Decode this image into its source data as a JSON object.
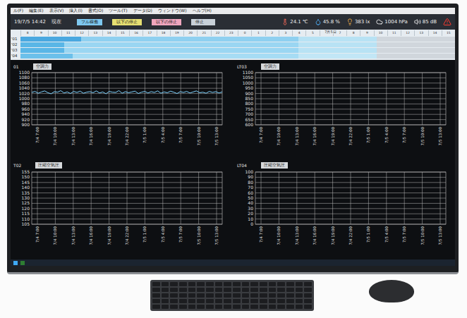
{
  "menu_bar": {
    "items": [
      "ル(F)",
      "編集(E)",
      "表示(V)",
      "挿入(I)",
      "書式(O)",
      "ツール(T)",
      "データ(D)",
      "ウィンドウ(W)",
      "ヘルプ(H)"
    ]
  },
  "toolbar": {
    "datetime": "19/7/5 14:42",
    "now_label": "現在",
    "legend": [
      {
        "label": "フル稼働",
        "color": "#7ec8f0"
      },
      {
        "label": "以下の停止",
        "color": "#e6df72"
      },
      {
        "label": "以下の停止",
        "color": "#f0a6be"
      },
      {
        "label": "停止",
        "color": "#c8d0d8"
      }
    ],
    "sensors": [
      {
        "kind": "temperature",
        "value": "24.1",
        "unit": "℃"
      },
      {
        "kind": "humidity",
        "value": "45.8",
        "unit": "%"
      },
      {
        "kind": "light",
        "value": "383",
        "unit": "lx"
      },
      {
        "kind": "pressure",
        "value": "1004",
        "unit": "hPa"
      },
      {
        "kind": "noise",
        "value": "85",
        "unit": "dB"
      }
    ],
    "alert": true
  },
  "timeline": {
    "date_label": "7月5日",
    "hours": [
      "8",
      "9",
      "10",
      "11",
      "12",
      "13",
      "14",
      "15",
      "16",
      "17",
      "18",
      "19",
      "20",
      "21",
      "22",
      "23",
      "0",
      "1",
      "2",
      "3",
      "4",
      "5",
      "6",
      "7",
      "8",
      "9",
      "10",
      "11",
      "12",
      "13",
      "14",
      "15"
    ],
    "rows": [
      {
        "label": "'01",
        "segments": [
          {
            "color": "#4aa8e0",
            "level": 0.14
          },
          {
            "color": "#8fd0f0",
            "level": 0.5
          },
          {
            "color": "#b8e2f4",
            "level": 0.18
          },
          {
            "color": "#d0d6dc",
            "level": 0.18
          }
        ]
      },
      {
        "label": "'02",
        "segments": [
          {
            "color": "#5ab6e6",
            "level": 0.1
          },
          {
            "color": "#9ad6f2",
            "level": 0.54
          },
          {
            "color": "#b8e2f4",
            "level": 0.18
          },
          {
            "color": "#d0d6dc",
            "level": 0.18
          }
        ]
      },
      {
        "label": "'03",
        "segments": [
          {
            "color": "#5ab6e6",
            "level": 0.1
          },
          {
            "color": "#9ad6f2",
            "level": 0.54
          },
          {
            "color": "#b8e2f4",
            "level": 0.18
          },
          {
            "color": "#d0d6dc",
            "level": 0.18
          }
        ]
      },
      {
        "label": "'04",
        "segments": [
          {
            "color": "#6cc0ea",
            "level": 0.12
          },
          {
            "color": "#a6dcf4",
            "level": 0.52
          },
          {
            "color": "#c2e6f6",
            "level": 0.18
          },
          {
            "color": "#d0d6dc",
            "level": 0.18
          }
        ]
      }
    ]
  },
  "charts": [
    {
      "id": "01",
      "title": "空調力",
      "y_ticks": [
        "1100",
        "1080",
        "1060",
        "1040",
        "1020",
        "1000",
        "980",
        "960",
        "940",
        "920",
        "900"
      ],
      "x_ticks": [
        "7/4 7:00",
        "7/4 10:00",
        "7/4 13:00",
        "7/4 16:00",
        "7/4 19:00",
        "7/4 22:00",
        "7/5 1:00",
        "7/5 4:00",
        "7/5 7:00",
        "7/5 10:00",
        "7/5 13:00"
      ],
      "series": [
        1024,
        1028,
        1021,
        1026,
        1030,
        1023,
        1019,
        1027,
        1025,
        1031,
        1022,
        1026,
        1020,
        1028,
        1024,
        1029,
        1021,
        1025,
        1027,
        1023,
        1030,
        1022,
        1026,
        1019,
        1028,
        1025,
        1024,
        1031,
        1021,
        1027,
        1023,
        1026,
        1029,
        1020,
        1025,
        1028,
        1022,
        1027,
        1024,
        1030,
        1021,
        1026,
        1023,
        1029,
        1025,
        1020,
        1027,
        1024,
        1028,
        1022,
        1026,
        1030,
        1023,
        1025,
        1021,
        1028,
        1024,
        1027,
        1022,
        1026
      ]
    },
    {
      "id": "LT03",
      "title": "空調力",
      "y_ticks": [
        "1100",
        "1050",
        "1000",
        "950",
        "900",
        "850",
        "800",
        "750",
        "700",
        "650",
        "600"
      ],
      "x_ticks": [
        "7/4 7:00",
        "7/4 10:00",
        "7/4 13:00",
        "7/4 16:00",
        "7/4 19:00",
        "7/4 22:00",
        "7/5 1:00",
        "7/5 4:00",
        "7/5 7:00",
        "7/5 10:00",
        "7/5 13:00"
      ],
      "series": []
    },
    {
      "id": "T02",
      "title": "圧縮空気圧",
      "y_ticks": [
        "155",
        "150",
        "145",
        "140",
        "135",
        "130",
        "125",
        "120",
        "115",
        "110",
        "105"
      ],
      "x_ticks": [
        "7/4 7:00",
        "7/4 10:00",
        "7/4 13:00",
        "7/4 16:00",
        "7/4 19:00",
        "7/4 22:00",
        "7/5 1:00",
        "7/5 4:00",
        "7/5 7:00",
        "7/5 10:00",
        "7/5 13:00"
      ],
      "series": []
    },
    {
      "id": "LT04",
      "title": "圧縮空気圧",
      "y_ticks": [
        "100",
        "90",
        "80",
        "70",
        "60",
        "50",
        "40",
        "30",
        "20",
        "10",
        "0"
      ],
      "x_ticks": [
        "7/4 7:00",
        "7/4 10:00",
        "7/4 13:00",
        "7/4 16:00",
        "7/4 19:00",
        "7/4 22:00",
        "7/5 1:00",
        "7/5 4:00",
        "7/5 7:00",
        "7/5 10:00",
        "7/5 13:00"
      ],
      "series": []
    }
  ]
}
